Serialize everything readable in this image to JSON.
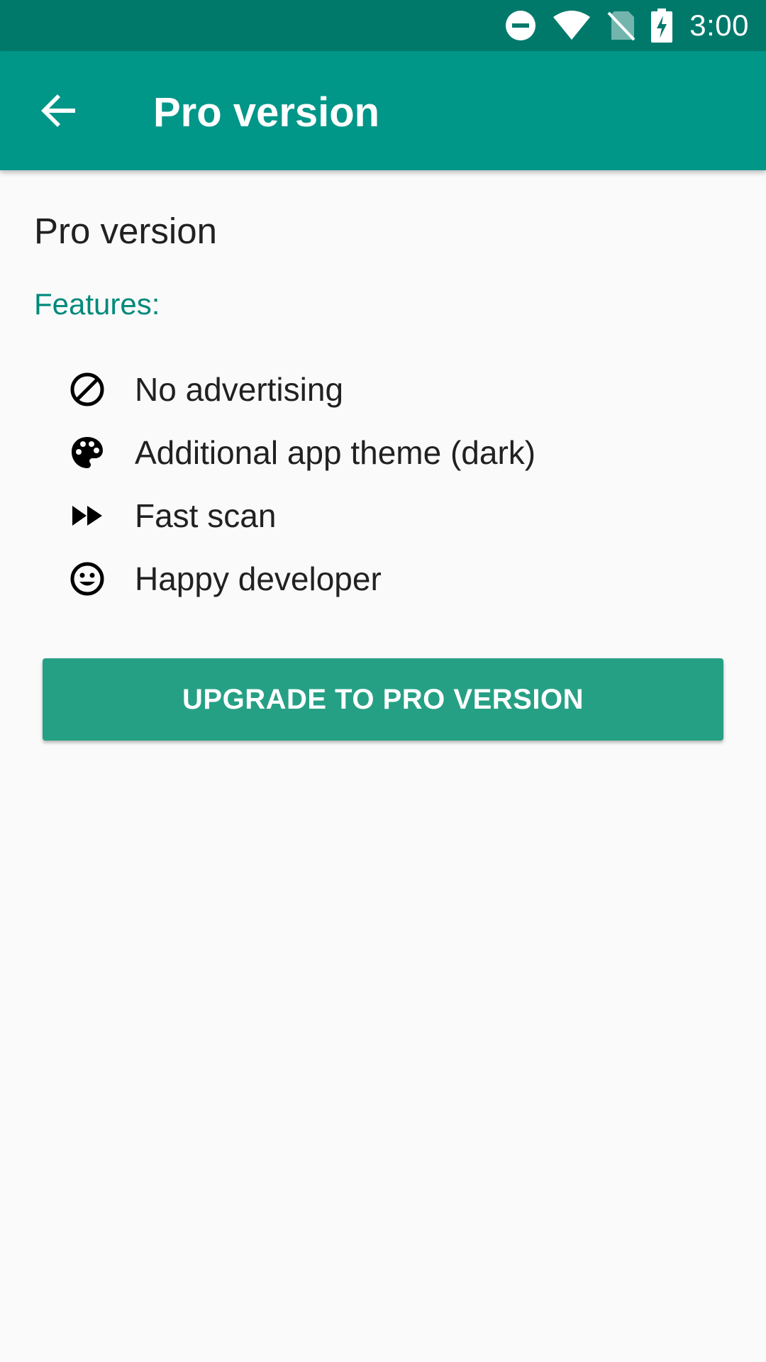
{
  "status_bar": {
    "time": "3:00",
    "icons": [
      "do-not-disturb-icon",
      "wifi-icon",
      "no-sim-icon",
      "battery-charging-icon"
    ],
    "color": "#00796b"
  },
  "app_bar": {
    "title": "Pro version",
    "back_icon": "arrow-back-icon",
    "color": "#009688"
  },
  "main": {
    "heading": "Pro version",
    "features_label": "Features:",
    "features": [
      {
        "icon": "block-icon",
        "label": "No advertising"
      },
      {
        "icon": "palette-icon",
        "label": "Additional app theme (dark)"
      },
      {
        "icon": "fast-forward-icon",
        "label": "Fast scan"
      },
      {
        "icon": "smiley-icon",
        "label": "Happy developer"
      }
    ],
    "upgrade_button": {
      "label": "UPGRADE TO PRO VERSION",
      "color": "#26a085"
    },
    "accent_color": "#00897b"
  }
}
